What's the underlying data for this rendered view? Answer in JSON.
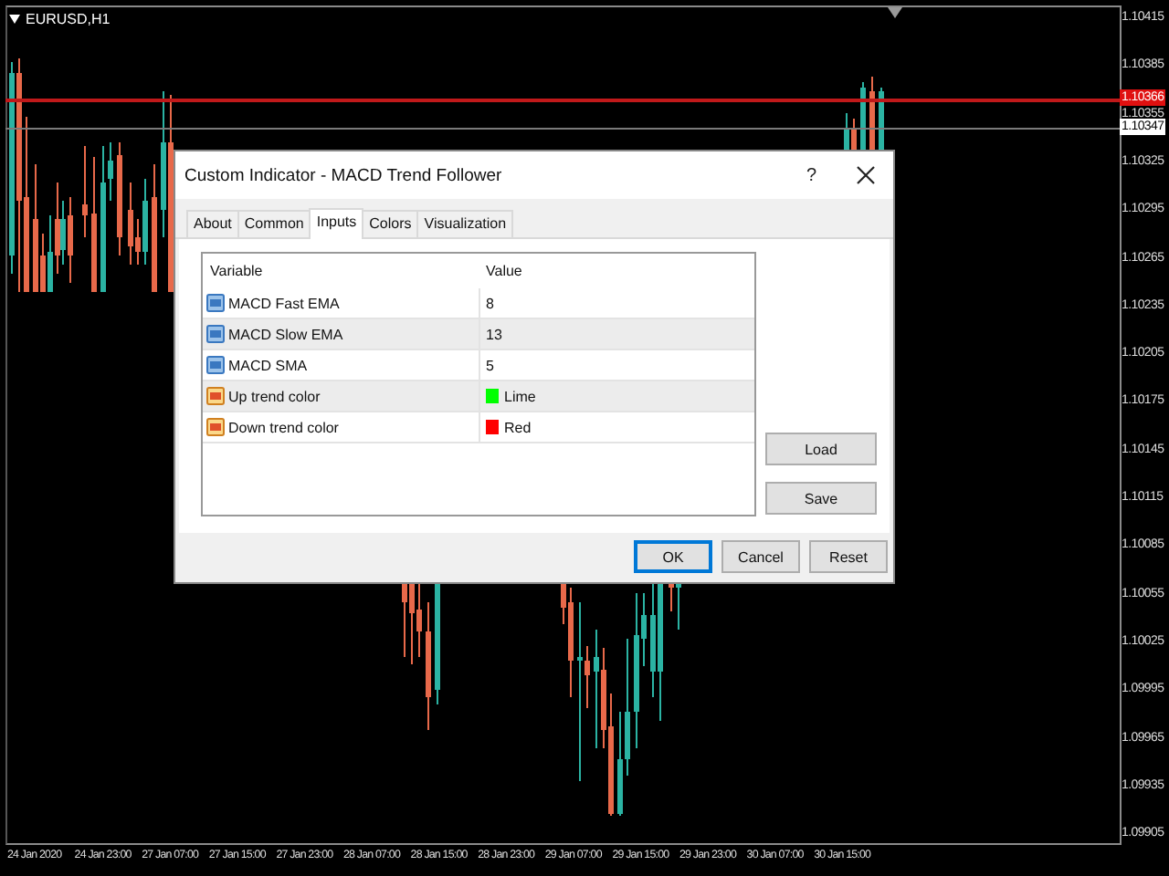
{
  "chart": {
    "symbol": "EURUSD,H1",
    "price_labels": [
      "1.10415",
      "1.10385",
      "1.10355",
      "1.10325",
      "1.10295",
      "1.10265",
      "1.10235",
      "1.10205",
      "1.10175",
      "1.10145",
      "1.10115",
      "1.10085",
      "1.10055",
      "1.10025",
      "1.09995",
      "1.09965",
      "1.09935",
      "1.09905"
    ],
    "price_tags": [
      {
        "kind": "bid",
        "text": "1.10366"
      },
      {
        "kind": "ask",
        "text": "1.10347"
      }
    ],
    "time_labels": [
      "24 Jan 2020",
      "24 Jan 23:00",
      "27 Jan 07:00",
      "27 Jan 15:00",
      "27 Jan 23:00",
      "28 Jan 07:00",
      "28 Jan 15:00",
      "28 Jan 23:00",
      "29 Jan 07:00",
      "29 Jan 15:00",
      "29 Jan 23:00",
      "30 Jan 07:00",
      "30 Jan 15:00"
    ]
  },
  "dialog": {
    "title": "Custom Indicator - MACD Trend Follower",
    "help": "?",
    "tabs": [
      {
        "label": "About",
        "selected": false
      },
      {
        "label": "Common",
        "selected": false
      },
      {
        "label": "Inputs",
        "selected": true
      },
      {
        "label": "Colors",
        "selected": false
      },
      {
        "label": "Visualization",
        "selected": false
      }
    ],
    "table": {
      "columns": [
        "Variable",
        "Value"
      ],
      "rows": [
        {
          "kind": "int",
          "name": "MACD Fast EMA",
          "value": "8"
        },
        {
          "kind": "int",
          "name": "MACD Slow EMA",
          "value": "13"
        },
        {
          "kind": "int",
          "name": "MACD SMA",
          "value": "5"
        },
        {
          "kind": "color",
          "name": "Up trend color",
          "value": "Lime",
          "color": "#00ff00"
        },
        {
          "kind": "color",
          "name": "Down trend color",
          "value": "Red",
          "color": "#ff0000"
        }
      ]
    },
    "side_buttons": [
      "Load",
      "Save"
    ],
    "buttons": [
      {
        "label": "OK",
        "default": true
      },
      {
        "label": "Cancel",
        "default": false
      },
      {
        "label": "Reset",
        "default": false
      }
    ]
  }
}
